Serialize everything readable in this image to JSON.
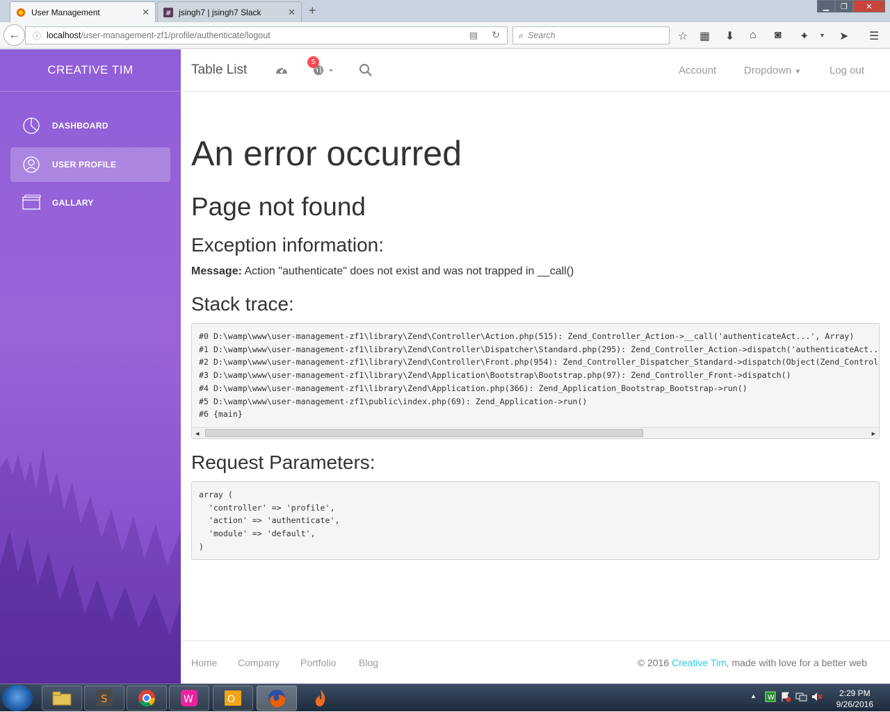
{
  "browser": {
    "tabs": [
      {
        "title": "User Management",
        "active": true
      },
      {
        "title": "jsingh7 | jsingh7 Slack",
        "active": false
      }
    ],
    "url_host": "localhost",
    "url_path": "/user-management-zf1/profile/authenticate/logout",
    "search_placeholder": "Search"
  },
  "sidebar": {
    "brand": "CREATIVE TIM",
    "items": [
      {
        "label": "DASHBOARD",
        "icon": "pie-chart-icon",
        "active": false
      },
      {
        "label": "USER PROFILE",
        "icon": "user-icon",
        "active": true
      },
      {
        "label": "GALLARY",
        "icon": "windows-icon",
        "active": false
      }
    ]
  },
  "topbar": {
    "title": "Table List",
    "notification_count": "5",
    "links": [
      "Account",
      "Dropdown",
      "Log out"
    ]
  },
  "error": {
    "heading": "An error occurred",
    "subheading": "Page not found",
    "exception_title": "Exception information:",
    "message_label": "Message:",
    "message_text": " Action \"authenticate\" does not exist and was not trapped in __call()",
    "stack_title": "Stack trace:",
    "stack_lines": [
      "#0 D:\\wamp\\www\\user-management-zf1\\library\\Zend\\Controller\\Action.php(515): Zend_Controller_Action->__call('authenticateAct...', Array)",
      "#1 D:\\wamp\\www\\user-management-zf1\\library\\Zend\\Controller\\Dispatcher\\Standard.php(295): Zend_Controller_Action->dispatch('authenticateAct...",
      "#2 D:\\wamp\\www\\user-management-zf1\\library\\Zend\\Controller\\Front.php(954): Zend_Controller_Dispatcher_Standard->dispatch(Object(Zend_Control",
      "#3 D:\\wamp\\www\\user-management-zf1\\library\\Zend\\Application\\Bootstrap\\Bootstrap.php(97): Zend_Controller_Front->dispatch()",
      "#4 D:\\wamp\\www\\user-management-zf1\\library\\Zend\\Application.php(366): Zend_Application_Bootstrap_Bootstrap->run()",
      "#5 D:\\wamp\\www\\user-management-zf1\\public\\index.php(69): Zend_Application->run()",
      "#6 {main}"
    ],
    "params_title": "Request Parameters:",
    "params_lines": [
      "array (",
      "  'controller' => 'profile',",
      "  'action' => 'authenticate',",
      "  'module' => 'default',",
      ")"
    ]
  },
  "footer": {
    "links": [
      "Home",
      "Company",
      "Portfolio",
      "Blog"
    ],
    "copyright_prefix": "© 2016 ",
    "copyright_brand": "Creative Tim",
    "copyright_suffix": ", made with love for a better web"
  },
  "taskbar": {
    "time": "2:29 PM",
    "date": "9/26/2016"
  },
  "colors": {
    "sidebar_top": "#8f5fd8",
    "sidebar_bottom": "#7a45c6",
    "badge": "#ff4a55",
    "brand_link": "#23ccef"
  }
}
